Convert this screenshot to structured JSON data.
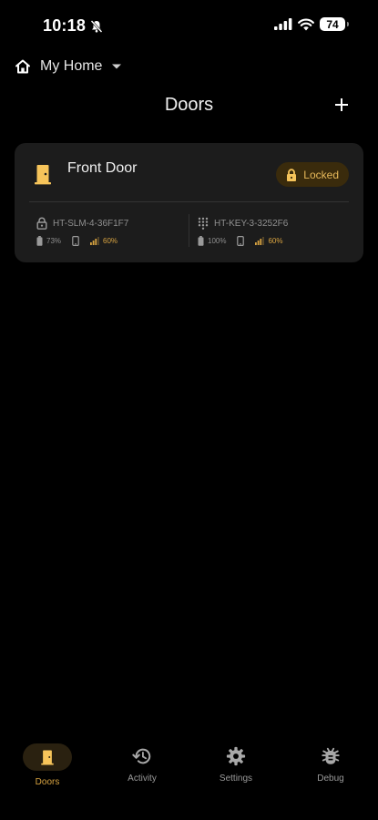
{
  "status_bar": {
    "time": "10:18",
    "battery_level": "74"
  },
  "home_selector": {
    "label": "My Home"
  },
  "header": {
    "title": "Doors"
  },
  "doors": [
    {
      "name": "Front Door",
      "status": "Locked",
      "devices": {
        "lock": {
          "id": "HT-SLM-4-36F1F7",
          "battery": "73%",
          "signal": "60%"
        },
        "keypad": {
          "id": "HT-KEY-3-3252F6",
          "battery": "100%",
          "signal": "60%"
        }
      }
    }
  ],
  "tabs": [
    {
      "label": "Doors",
      "icon": "door-icon",
      "active": true
    },
    {
      "label": "Activity",
      "icon": "history-icon",
      "active": false
    },
    {
      "label": "Settings",
      "icon": "gear-icon",
      "active": false
    },
    {
      "label": "Debug",
      "icon": "bug-icon",
      "active": false
    }
  ],
  "colors": {
    "accent": "#d9a441",
    "card_bg": "#1c1c1c",
    "badge_bg": "#3a2b0c",
    "background": "#000000"
  }
}
